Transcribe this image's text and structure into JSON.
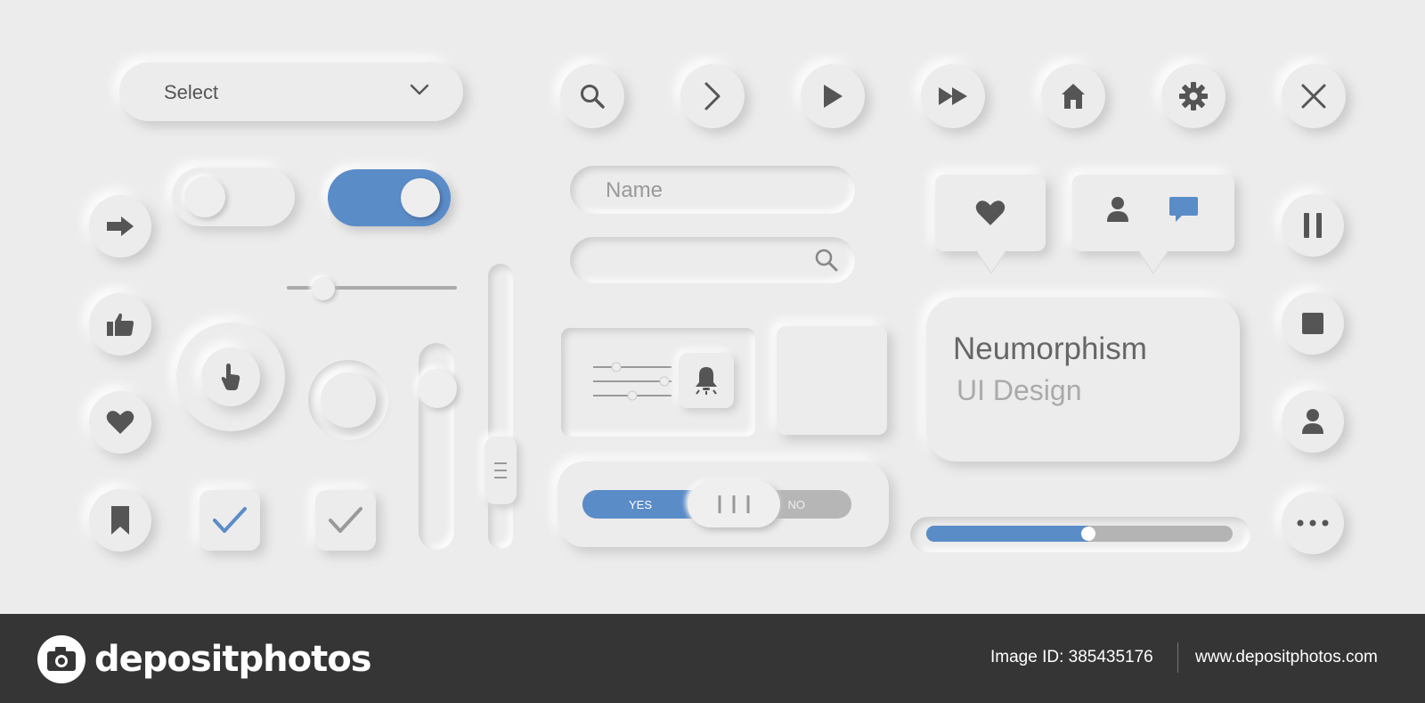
{
  "select": {
    "label": "Select"
  },
  "name_field": {
    "placeholder": "Name"
  },
  "yes_no": {
    "yes_label": "YES",
    "no_label": "NO"
  },
  "card": {
    "title": "Neumorphism",
    "subtitle": "UI Design"
  },
  "progress": {
    "value_percent": 53
  },
  "top_icons": [
    "search-icon",
    "chevron-right-icon",
    "play-icon",
    "fast-forward-icon",
    "home-icon",
    "gear-icon",
    "close-icon"
  ],
  "left_icons": [
    "arrow-right-icon",
    "thumbs-up-icon",
    "heart-icon",
    "bookmark-icon"
  ],
  "right_icons": [
    "pause-icon",
    "stop-icon",
    "user-icon",
    "more-icon"
  ],
  "colors": {
    "accent": "#5a8cc8",
    "background": "#ececec",
    "icon": "#555555",
    "banner": "#353535"
  },
  "banner": {
    "brand": "depositphotos",
    "image_id": "Image ID: 385435176",
    "site": "www.depositphotos.com"
  }
}
